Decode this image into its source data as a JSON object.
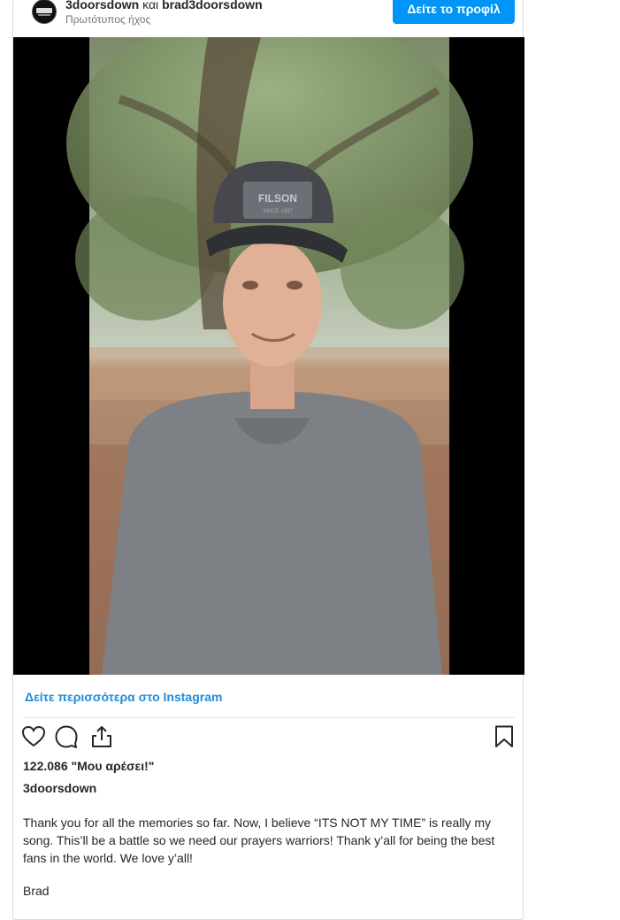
{
  "header": {
    "account_primary": "3doorsdown",
    "conjunction": "και",
    "account_secondary": "brad3doorsdown",
    "audio_label": "Πρωτότυπος ήχος",
    "profile_button": "Δείτε το προφίλ"
  },
  "media": {
    "cap_brand": "FILSON",
    "cap_brand_sub": "SINCE 1897"
  },
  "footer": {
    "see_more_link": "Δείτε περισσότερα στο Instagram",
    "likes_text": "122.086 \"Μου αρέσει!\"",
    "owner": "3doorsdown",
    "caption": "Thank you for all the memories so far. Now, I believe “ITS NOT MY TIME” is really my song. This’ll be a battle so we need our prayers warriors! Thank y’all for being the best fans in the world. We love y’all!",
    "signoff": "Brad"
  },
  "icons": [
    "heart-icon",
    "comment-icon",
    "share-icon",
    "bookmark-icon"
  ],
  "colors": {
    "accent": "#0095f6",
    "link": "#1d8fd8",
    "text": "#262626",
    "muted": "#737373"
  }
}
